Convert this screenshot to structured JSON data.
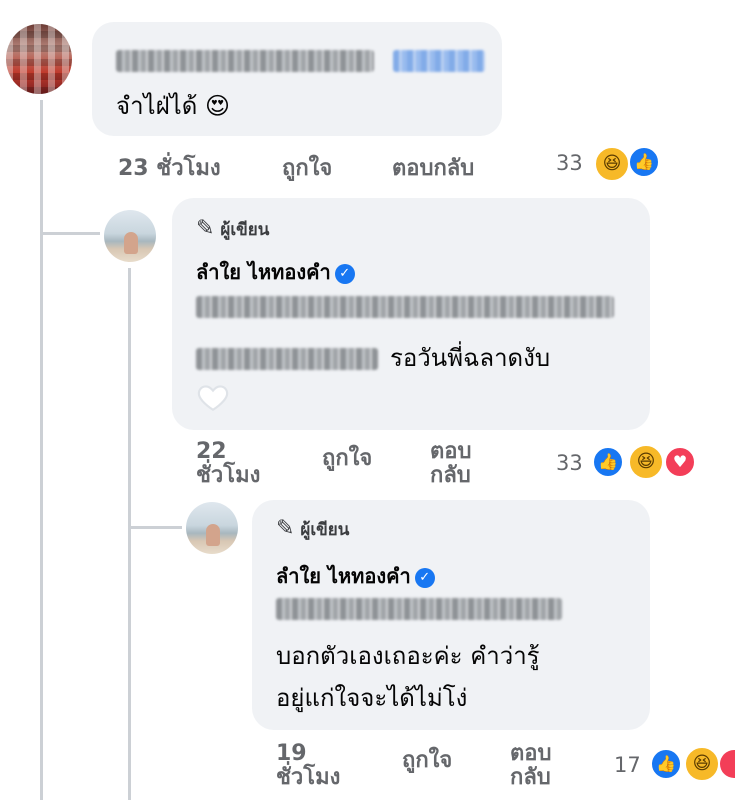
{
  "comment1": {
    "text": "จำไฝ่ได้",
    "emoji": "😍",
    "time": "23 ชั่วโมง",
    "like": "ถูกใจ",
    "reply": "ตอบกลับ",
    "reaction_count": "33",
    "reactions": [
      "haha",
      "like"
    ]
  },
  "reply1": {
    "author_tag": "ผู้เขียน",
    "name": "ลำใย ไหทองคำ",
    "text": "รอวันพี่ฉลาดงับ",
    "time_line1": "22",
    "time_line2": "ชั่วโมง",
    "like": "ถูกใจ",
    "reply_line1": "ตอบ",
    "reply_line2": "กลับ",
    "reaction_count": "33",
    "reactions": [
      "like",
      "haha",
      "love"
    ]
  },
  "reply2": {
    "author_tag": "ผู้เขียน",
    "name": "ลำใย ไหทองคำ",
    "text_line1": "บอกตัวเองเถอะค่ะ คำว่ารู้",
    "text_line2": "อยู่แก่ใจจะได้ไม่โง่",
    "time_line1": "19",
    "time_line2": "ชั่วโมง",
    "like": "ถูกใจ",
    "reply_line1": "ตอบ",
    "reply_line2": "กลับ",
    "reaction_count": "17",
    "reactions": [
      "like",
      "haha",
      "love"
    ]
  },
  "icons": {
    "pencil": "✎",
    "verified": "✓",
    "haha": "😆",
    "like": "👍",
    "love": "♥"
  },
  "colors": {
    "bubble": "#f0f2f5",
    "meta": "#65676b",
    "verified": "#1877f2"
  }
}
